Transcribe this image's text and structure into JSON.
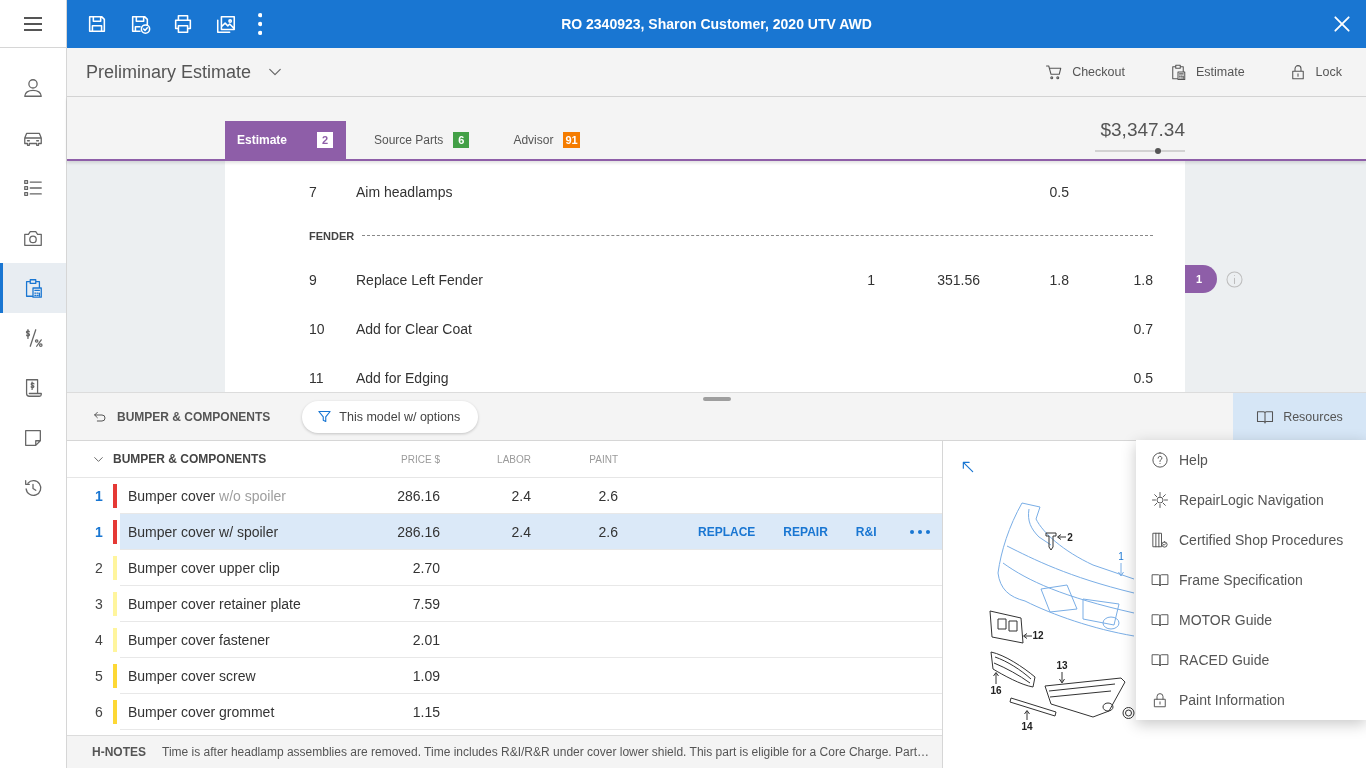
{
  "sidebar": {
    "items": [
      {
        "selected": false
      },
      {
        "selected": false
      },
      {
        "selected": false
      },
      {
        "selected": false
      },
      {
        "selected": true
      },
      {
        "selected": false
      },
      {
        "selected": false
      },
      {
        "selected": false
      },
      {
        "selected": false
      }
    ]
  },
  "window": {
    "title": "RO 2340923, Sharon Customer, 2020 UTV AWD"
  },
  "header": {
    "title": "Preliminary Estimate",
    "actions": [
      "Checkout",
      "Estimate",
      "Lock"
    ]
  },
  "tabs": [
    {
      "label": "Estimate",
      "count": "2",
      "color": "#8e5ea8",
      "selected": true
    },
    {
      "label": "Source Parts",
      "count": "6",
      "color": "#43a047",
      "selected": false
    },
    {
      "label": "Advisor",
      "count": "91",
      "color": "#f57c00",
      "selected": false
    }
  ],
  "total": {
    "amount": "$3,347.34",
    "level": 0.7
  },
  "estimate_lines": [
    {
      "kind": "line",
      "number": "7",
      "description": "Aim headlamps",
      "labor": "0.5"
    },
    {
      "kind": "section",
      "title": "FENDER"
    },
    {
      "kind": "line",
      "number": "9",
      "description": "Replace Left Fender",
      "qty": "1",
      "price": "351.56",
      "labor": "1.8",
      "paint": "1.8",
      "badge": "1"
    },
    {
      "kind": "line",
      "number": "10",
      "description": "Add for Clear Coat",
      "paint": "0.7"
    },
    {
      "kind": "line",
      "number": "11",
      "description": "Add for Edging",
      "paint": "0.5"
    }
  ],
  "parts_panel": {
    "back_label": "BUMPER & COMPONENTS",
    "filter": "This model w/ options",
    "resources": {
      "label": "Resources",
      "open": true,
      "menu": [
        "Help",
        "RepairLogic Navigation",
        "Certified Shop Procedures",
        "Frame Specification",
        "MOTOR Guide",
        "RACED Guide",
        "Paint Information"
      ]
    },
    "table": {
      "group": "BUMPER & COMPONENTS",
      "expanded": true,
      "columns": [
        "PRICE $",
        "LABOR",
        "PAINT"
      ],
      "row_actions": [
        "REPLACE",
        "REPAIR",
        "R&I"
      ],
      "rows": [
        {
          "qty": "1",
          "highlighted": true,
          "color": "#e53935",
          "description": "Bumper cover",
          "option": "w/o spoiler",
          "price": "286.16",
          "labor": "2.4",
          "paint": "2.6",
          "selected": false
        },
        {
          "qty": "1",
          "highlighted": true,
          "color": "#e53935",
          "description": "Bumper cover w/ spoiler",
          "price": "286.16",
          "labor": "2.4",
          "paint": "2.6",
          "selected": true
        },
        {
          "qty": "2",
          "highlighted": false,
          "color": "#fff59d",
          "description": "Bumper cover upper clip",
          "price": "2.70",
          "selected": false
        },
        {
          "qty": "3",
          "highlighted": false,
          "color": "#fff59d",
          "description": "Bumper cover retainer plate",
          "price": "7.59",
          "selected": false
        },
        {
          "qty": "4",
          "highlighted": false,
          "color": "#fff59d",
          "description": "Bumper cover fastener",
          "price": "2.01",
          "selected": false
        },
        {
          "qty": "5",
          "highlighted": false,
          "color": "#fdd835",
          "description": "Bumper cover screw",
          "price": "1.09",
          "selected": false
        },
        {
          "qty": "6",
          "highlighted": false,
          "color": "#fdd835",
          "description": "Bumper cover grommet",
          "price": "1.15",
          "selected": false
        }
      ]
    },
    "diagram": {
      "callouts": [
        {
          "label": "2",
          "selected": false
        },
        {
          "label": "1",
          "selected": true
        },
        {
          "label": "12",
          "selected": false
        },
        {
          "label": "13",
          "selected": false
        },
        {
          "label": "16",
          "selected": false
        },
        {
          "label": "14",
          "selected": false
        }
      ]
    },
    "notes": {
      "label": "H-NOTES",
      "text": "Time is after headlamp assemblies are removed. Time includes R&I/R&R under cover lower shield. This part is eligible for a Core Charge. Part…"
    }
  }
}
